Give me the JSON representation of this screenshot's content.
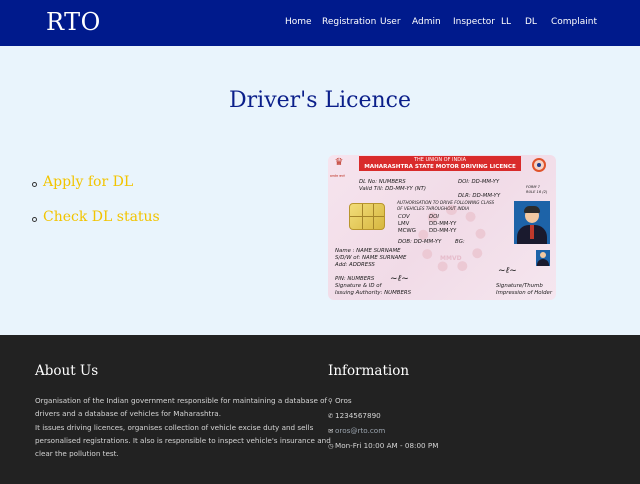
{
  "navbar": {
    "brand": "RTO",
    "links": [
      "Home",
      "Registration",
      "User",
      "Admin",
      "Inspector",
      "LL",
      "DL",
      "Complaint"
    ]
  },
  "main": {
    "title": "Driver's Licence",
    "options": [
      "Apply for DL",
      "Check DL status"
    ]
  },
  "licence_card": {
    "union": "THE UNION OF INDIA",
    "heading": "MAHARASHTRA STATE MOTOR DRIVING LICENCE",
    "emblem_caption": "सत्यमेव जयते",
    "dl_no": "DL No: NUMBERS",
    "doi": "DOI: DD-MM-YY",
    "valid_till": "Valid Till: DD-MM-YY (NT)",
    "dlr": "DLR: DD-MM-YY",
    "form": "FORM 7",
    "rule": "RULE 16 (2)",
    "authorisation_1": "AUTHORISATION TO DRIVE FOLLOWING CLASS",
    "authorisation_2": "OF VEHICLES THROUGHOUT INDIA",
    "cov_label": "COV",
    "doi_label": "DOI",
    "lmv": "LMV",
    "lmv_date": "DD-MM-YY",
    "mcwg": "MCWG",
    "mcwg_date": "DD-MM-YY",
    "dob": "DOB:  DD-MM-YY",
    "bg": "BG:",
    "watermark": "MMVD",
    "name": "Name  :  NAME SURNAME",
    "sdw": "S/D/W of: NAME SURNAME",
    "address": "Add: ADDRESS",
    "pin": "PIN: NUMBERS",
    "signature_label_1": "Signature & ID of",
    "signature_label_2": "Issuing Authority: NUMBERS",
    "holder_label_1": "Signature/Thumb",
    "holder_label_2": "Impression of Holder",
    "colors": {
      "band": "#d92b2b",
      "background": "#f4e1eb"
    }
  },
  "footer": {
    "about_title": "About Us",
    "about_lines": [
      "Organisation of the Indian government responsible for maintaining a database of",
      "drivers and a database of vehicles for Maharashtra.",
      "It issues driving licences, organises collection of vehicle excise duty and sells",
      "personalised registrations. It also is responsible to inspect vehicle's insurance and",
      "clear the pollution test."
    ],
    "info_title": "Information",
    "info": {
      "location": "Oros",
      "phone": "1234567890",
      "email": "oros@rto.com",
      "hours": "Mon-Fri 10:00 AM - 08:00 PM"
    },
    "icons": {
      "location": "map-marker-icon",
      "phone": "phone-icon",
      "email": "envelope-icon",
      "hours": "clock-icon"
    }
  },
  "colors": {
    "navbar": "#001a8c",
    "page_background": "#e9f4fc",
    "title": "#0b1f8a",
    "option_links": "#f2c400",
    "footer": "#222222"
  }
}
